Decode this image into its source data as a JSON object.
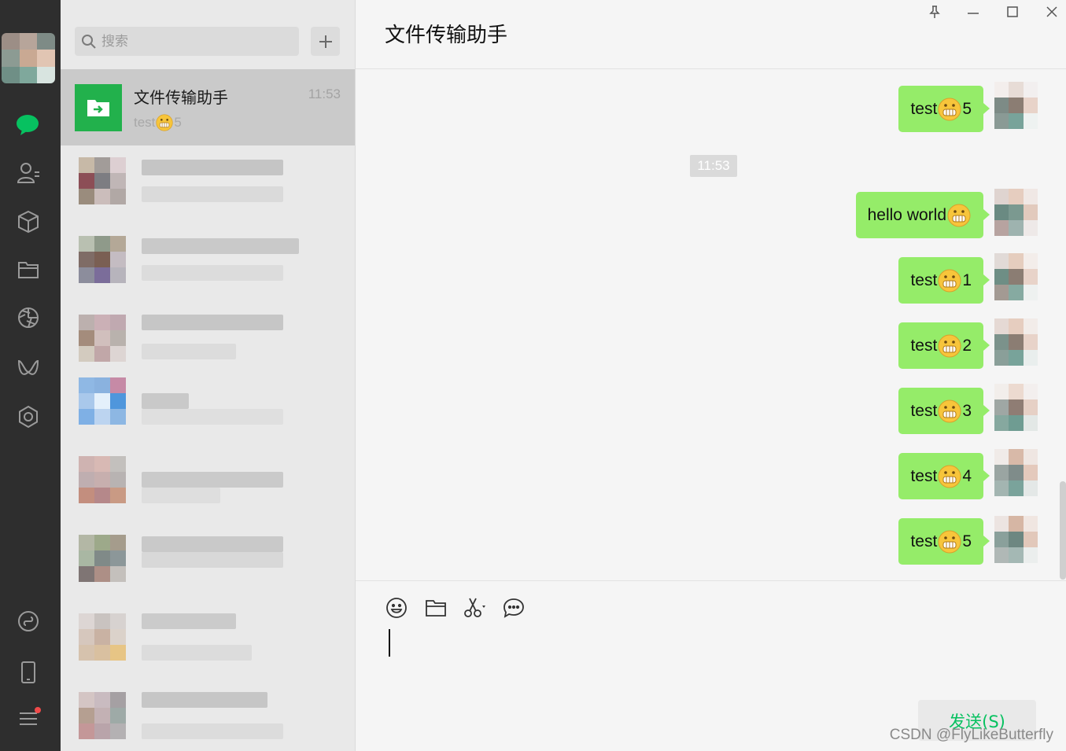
{
  "app": {
    "window_title": "文件传输助手",
    "search_placeholder": "搜索"
  },
  "conversation_list": {
    "active": {
      "name": "文件传输助手",
      "time": "11:53",
      "preview_prefix": "test",
      "preview_suffix": "5",
      "preview_emoji": "grimace-emoji"
    }
  },
  "chat": {
    "messages": [
      {
        "text_before": "test",
        "emoji": "grimace-emoji",
        "text_after": "5"
      },
      {
        "text_before": "hello world",
        "emoji": "grimace-emoji",
        "text_after": ""
      },
      {
        "text_before": "test",
        "emoji": "grimace-emoji",
        "text_after": "1"
      },
      {
        "text_before": "test",
        "emoji": "grimace-emoji",
        "text_after": "2"
      },
      {
        "text_before": "test",
        "emoji": "grimace-emoji",
        "text_after": "3"
      },
      {
        "text_before": "test",
        "emoji": "grimace-emoji",
        "text_after": "4"
      },
      {
        "text_before": "test",
        "emoji": "grimace-emoji",
        "text_after": "5"
      }
    ],
    "timestamp": "11:53",
    "send_label": "发送(S)"
  },
  "watermark": "CSDN @FlyLikeButterfly",
  "nav_icons": [
    "chat-icon",
    "contacts-icon",
    "favorites-icon",
    "files-icon",
    "moments-icon",
    "channels-icon",
    "mini-programs-icon",
    "phone-icon",
    "settings-menu-icon"
  ],
  "colors": {
    "accent": "#07c160",
    "bubble": "#95ec69",
    "rail": "#2e2e2e"
  }
}
